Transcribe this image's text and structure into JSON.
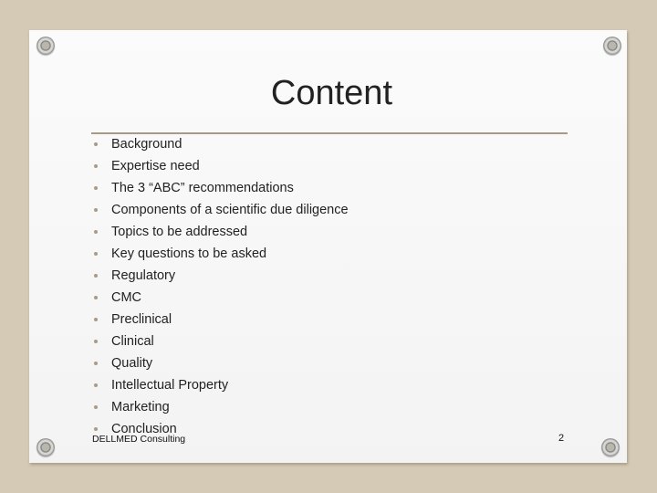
{
  "slide": {
    "title": "Content",
    "items": [
      "Background",
      "Expertise need",
      "The 3 “ABC” recommendations",
      "Components of a scientific due diligence",
      "Topics to be addressed",
      "Key questions to be asked",
      "Regulatory",
      "CMC",
      "Preclinical",
      "Clinical",
      "Quality",
      "Intellectual Property",
      "Marketing",
      "Conclusion"
    ],
    "footer": "DELLMED Consulting",
    "page_number": "2"
  },
  "colors": {
    "background": "#d5cab6",
    "paper": "#f7f7f7",
    "accent_rule": "#a89a86",
    "text": "#222222"
  }
}
